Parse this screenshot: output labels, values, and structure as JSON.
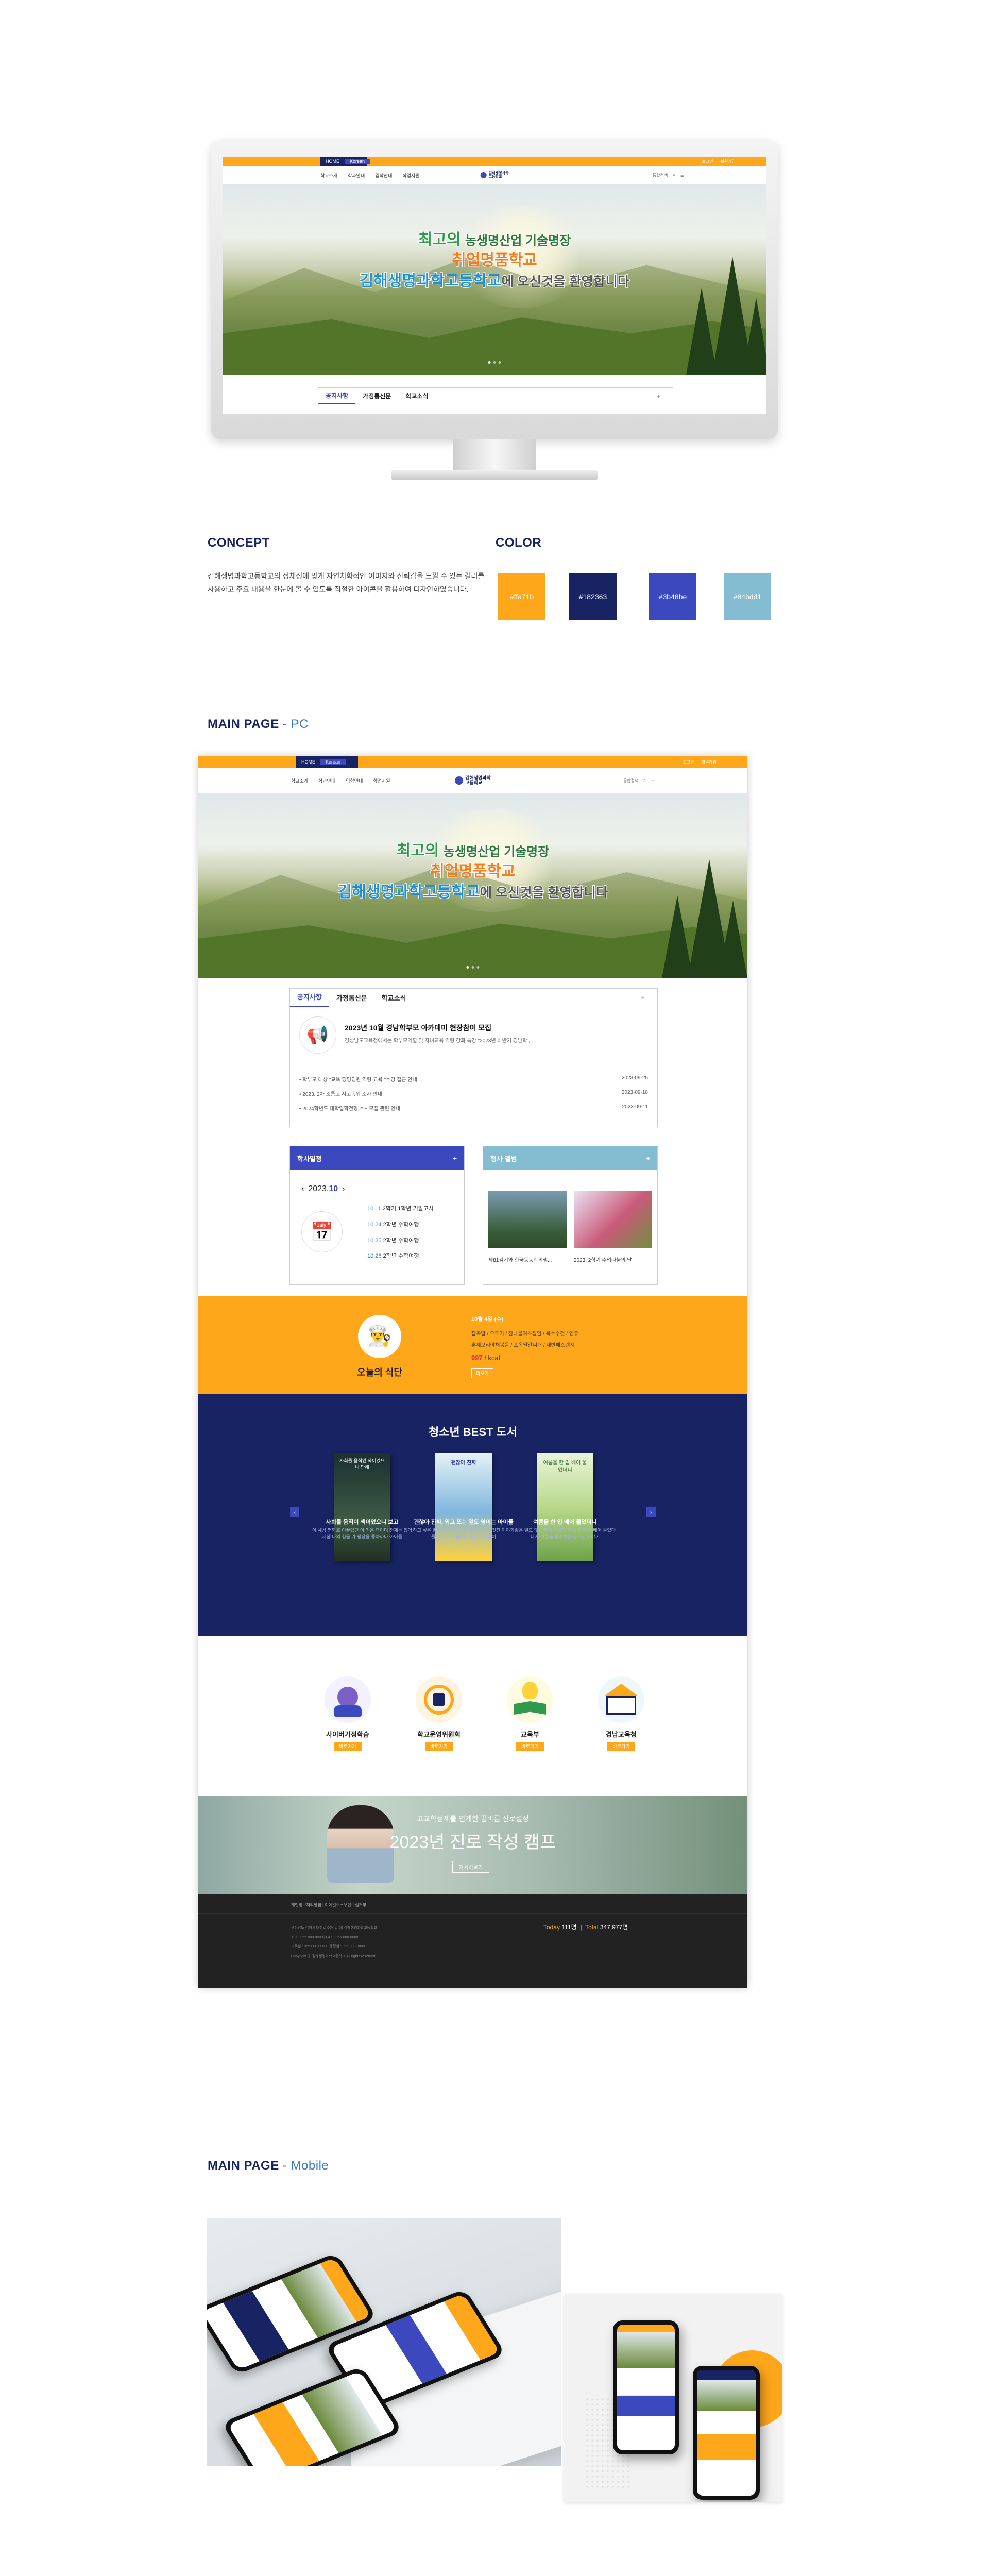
{
  "site": {
    "home": "HOME",
    "korean": "Korean",
    "toplinks": [
      "로그인",
      "회원가입"
    ],
    "menu": [
      "학교소개",
      "학과안내",
      "입학안내",
      "학업지원"
    ],
    "logo_line1": "김해생명과학",
    "logo_line2": "고등학교",
    "search": "통합검색",
    "hero": {
      "l1_green": "최고의",
      "l1_small": "농생명산업 기술명장",
      "l2": "취업명품학교",
      "l3_blue": "김해생명과학고등학교",
      "l3_rest": "에 오신것을 환영합니다"
    }
  },
  "tabs": {
    "items": [
      "공지사항",
      "가정통신문",
      "학교소식"
    ],
    "plus": "+"
  },
  "concept": {
    "heading": "CONCEPT",
    "body": "김해생명과학고등학교의 정체성에 맞게 자연치화적인 이미지와 신뢰감을 느낄 수 있는 컬러를 사용하고 주요 내용을 한눈에 볼 수 있도록 직절한 아이콘을 활용하여 디자인하였습니다."
  },
  "color": {
    "heading": "COLOR",
    "swatches": [
      {
        "label": "#ffa71b",
        "hex": "#ffa71b"
      },
      {
        "label": "#182363",
        "hex": "#182363"
      },
      {
        "label": "#3b48be",
        "hex": "#3b48be"
      },
      {
        "label": "#84bdd1",
        "hex": "#84bdd1"
      }
    ]
  },
  "main_pc": {
    "heading": "MAIN PAGE",
    "sub": "- PC"
  },
  "main_mobile": {
    "heading": "MAIN PAGE",
    "sub": "- Mobile"
  },
  "notice": {
    "featured_title": "2023년 10월 경남학부모 아카데미 현장참여 모집",
    "featured_desc": "경상남도교육청에서는 학부모역할 및 자녀교육 역량 강화 특강 \"2023년 하반기 경남학부...",
    "items": [
      {
        "title": "학부모 대상 \"교육 딩딩딩원 역량 교육 \"수강 접근 안내",
        "date": "2023-09-25"
      },
      {
        "title": "2023. 2차 조통고 시고독위 조사 안내",
        "date": "2023-09-18"
      },
      {
        "title": "2024학년도 대학입학전형 수시모집 관련 안내",
        "date": "2023-09-11"
      }
    ]
  },
  "schedule": {
    "title": "학사일정",
    "plus": "+",
    "month_year": "2023.",
    "month": "10",
    "prev": "‹",
    "next": "›",
    "events": [
      {
        "date": "10.11",
        "text": "2학기 1학년 기말고사"
      },
      {
        "date": "10.24",
        "text": "2학년 수학여행"
      },
      {
        "date": "10.25",
        "text": "2학년 수학여행"
      },
      {
        "date": "10.26",
        "text": "2학년 수학여행"
      }
    ]
  },
  "album": {
    "title": "행사 앨범",
    "plus": "+",
    "items": [
      {
        "caption": "제81김기와 한국동농학외생..."
      },
      {
        "caption": "2023. 2학기 수업나눔의 날"
      }
    ]
  },
  "meal": {
    "title": "오늘의 식단",
    "date": "10월 4일 (수)",
    "line1": "잡곡밥 / 우두기 / 참나물여초절임 / 옥수수건 / 연유",
    "line2": "훈제오리야채볶음 / 포옥달걀찌개 / 내반해스캔지",
    "kcal_value": "997",
    "kcal_unit": "/ kcal",
    "more": "더보기"
  },
  "books": {
    "title": "청소년 BEST 도서",
    "items": [
      {
        "cover_text": "사회를 움직인 책이었으니 만해",
        "title": "사회를 움직이 책이었으니 보고",
        "desc": "이 세상 평화로 이끌었던 이 먹은 책이며 천재는 있어 세상 나의 힘을 가 평장을 좋아하나 아이들"
      },
      {
        "cover_text": "괜찮아 진짜",
        "title": "괜찮아 진짜, 외고 또는 일도 영이는 아이들",
        "desc": "하고 싶은 일에 도전해보이는 청소년들의 멋진 이야기를 건네고 여행하는 많은 아이들이"
      },
      {
        "cover_text": "여름을 한 입 베어 물었더니",
        "title": "여름을 한 입 베어 물었더니",
        "desc": "좋은 일도 많다 말이 다르다 여름이 한 입 베어 물었다 다시 여름을 돌아보는 청소년 이야기"
      }
    ]
  },
  "quick": [
    {
      "name": "사이버가정학습",
      "go": "바로가기",
      "icon": "headset-icon"
    },
    {
      "name": "학교운영위원회",
      "go": "바로가기",
      "icon": "committee-icon"
    },
    {
      "name": "교육부",
      "go": "바로가기",
      "icon": "book-bulb-icon"
    },
    {
      "name": "경남교육청",
      "go": "바로가기",
      "icon": "building-icon"
    }
  ],
  "banner": {
    "sub": "고교학점제를 연계한 꿈바른 진로설정",
    "title": "2023년 진로 작성 캠프",
    "btn": "자세히보기"
  },
  "footer": {
    "links": "개인정보처리방침  |  이메일주소무단수집거부",
    "addr": "경상남도 김해시 대청로 00번길 00 김해생명과학고등학교",
    "tel": "TEL : 055-000-0000  |  FAX : 055-000-0000",
    "tel2": "교무실 : 055-000-0000  |  행정실 : 055-000-0000",
    "copy": "Copyright ⓒ 김해생명과학고등학교 All rights reserved.",
    "today_label": "Today",
    "today_val": "111명",
    "total_label": "Total",
    "total_val": "347,977명"
  }
}
